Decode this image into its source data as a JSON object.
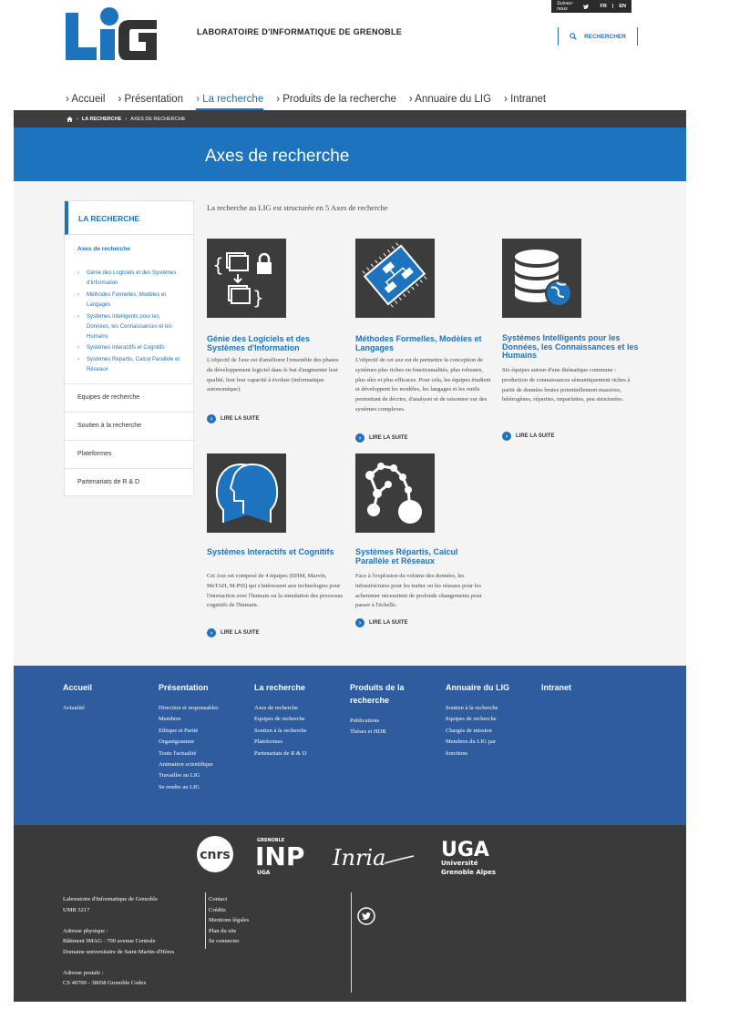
{
  "header": {
    "logo_text": "LIG",
    "lab_title": "LABORATOIRE D'INFORMATIQUE DE GRENOBLE",
    "follow_label": "Suivez-nous",
    "lang_fr": "FR",
    "lang_sep": "|",
    "lang_en": "EN",
    "search_label": "RECHERCHER"
  },
  "nav": [
    {
      "label": "› Accueil",
      "active": false
    },
    {
      "label": "› Présentation",
      "active": false
    },
    {
      "label": "› La recherche",
      "active": true
    },
    {
      "label": "› Produits de la recherche",
      "active": false
    },
    {
      "label": "› Annuaire du LIG",
      "active": false
    },
    {
      "label": "› Intranet",
      "active": false
    }
  ],
  "breadcrumb": {
    "sep": "›",
    "parent": "LA RECHERCHE",
    "current": "AXES DE RECHERCHE"
  },
  "banner": {
    "title": "Axes de recherche"
  },
  "sidebar": {
    "heading": "LA RECHERCHE",
    "active": "Axes de recherche",
    "subitems": [
      "Génie des Logiciels et des Systèmes d'Information",
      "Méthodes Formelles, Modèles et Langages",
      "Systèmes Intelligents pour les Données, les Connaissances et les Humains",
      "Systèmes Interactifs et Cognitifs",
      "Systèmes Répartis, Calcul Parallèle et Réseaux"
    ],
    "items": [
      "Equipes de recherche",
      "Soutien à la recherche",
      "Plateformes",
      "Partenariats de R & D"
    ]
  },
  "main": {
    "intro": "La recherche au LIG est structurée en 5 Axes de recherche",
    "more_label": "LIRE LA SUITE",
    "cards": [
      {
        "title": "Génie des Logiciels et des Systèmes d'Information",
        "icon": "software-lock-icon",
        "desc": "L'objectif de l'axe est d'améliorer l'ensemble des phases du développement logiciel dans le but d'augmenter leur qualité, leur leur capacité à évoluer (informatique autonomique)."
      },
      {
        "title": "Méthodes Formelles, Modèles et Langages",
        "icon": "chip-diagram-icon",
        "desc": "L'objectif de cet axe est de permettre la conception de systèmes plus riches en fonctionnalités, plus robustes, plus sûrs et plus efficaces. Pour cela, les équipes étudient et développent les modèles, les langages et les outils permettant de décrire, d'analyser et de raisonner sur des systèmes complexes."
      },
      {
        "title": "Systèmes Intelligents pour les Données, les Connaissances et les Humains",
        "icon": "database-globe-icon",
        "desc": "Six équipes autour d'une thématique commune : production de connaissances sémantiquement riches à partir de données brutes potentiellement massives, hétérogènes, réparties, imparfaites, peu structurées."
      },
      {
        "title": "Systèmes Interactifs et Cognitifs",
        "icon": "heads-icon",
        "desc": "Cet Axe est composé de 4 équipes (IIHM, Marvin, MeTAH, M-PSI) qui s'intéressent aux technologies pour l'interaction avec l'humain ou la simulation des processus cognitifs de l'humain."
      },
      {
        "title": "Systèmes Répartis, Calcul Parallèle et Réseaux",
        "icon": "network-nodes-icon",
        "desc": "Face à l'explosion du volume des données, les infrastructures pour les traiter ou les réseaux pour les acheminer nécessitent de profonds changements pour passer à l'échelle."
      }
    ]
  },
  "footer": {
    "columns": [
      {
        "heading": "Accueil",
        "links": [
          "Actualité"
        ]
      },
      {
        "heading": "Présentation",
        "links": [
          "Direction et responsables",
          "Membres",
          "Ethique et Parité",
          "Organigramme",
          "Toute l'actualité",
          "Animation scientifique",
          "Travailler au LIG",
          "Se rendre au LIG"
        ]
      },
      {
        "heading": "La recherche",
        "links": [
          "Axes de recherche",
          "Equipes de recherche",
          "Soutien à la recherche",
          "Plateformes",
          "Partenariats de R & D"
        ]
      },
      {
        "heading": "Produits de la recherche",
        "links": [
          "Publications",
          "Thèses et HDR"
        ]
      },
      {
        "heading": "Annuaire du LIG",
        "links": [
          "Soutien à la recherche",
          "Equipes de recherche",
          "Chargés de mission",
          "Membres du LIG par fonctions"
        ]
      },
      {
        "heading": "Intranet",
        "links": []
      }
    ],
    "partners": {
      "cnrs": "cnrs",
      "inp_top": "GRENOBLE",
      "inp": "INP",
      "inp_sub": "UGA",
      "inria": "Inria",
      "uga": "UGA",
      "uga_line1": "Université",
      "uga_line2": "Grenoble Alpes"
    },
    "address_lines": [
      "Laboratoire d'Informatique de Grenoble",
      "UMR 5217",
      "",
      "Adresse physique :",
      "Bâtiment IMAG - 700 avenue Centrale",
      "Domaine universitaire de Saint-Martin-d'Hères",
      "",
      "Adresse postale :",
      "CS 40700 - 38058 Grenoble Cedex"
    ],
    "links": [
      "Contact",
      "Crédits",
      "Mentions légales",
      "Plan du site",
      "Se connecter"
    ]
  },
  "colors": {
    "accent": "#1e73be",
    "footer_blue": "#2e5c9e",
    "footer_dark": "#3a3a3a",
    "breadcrumb": "#3d3d3d"
  }
}
